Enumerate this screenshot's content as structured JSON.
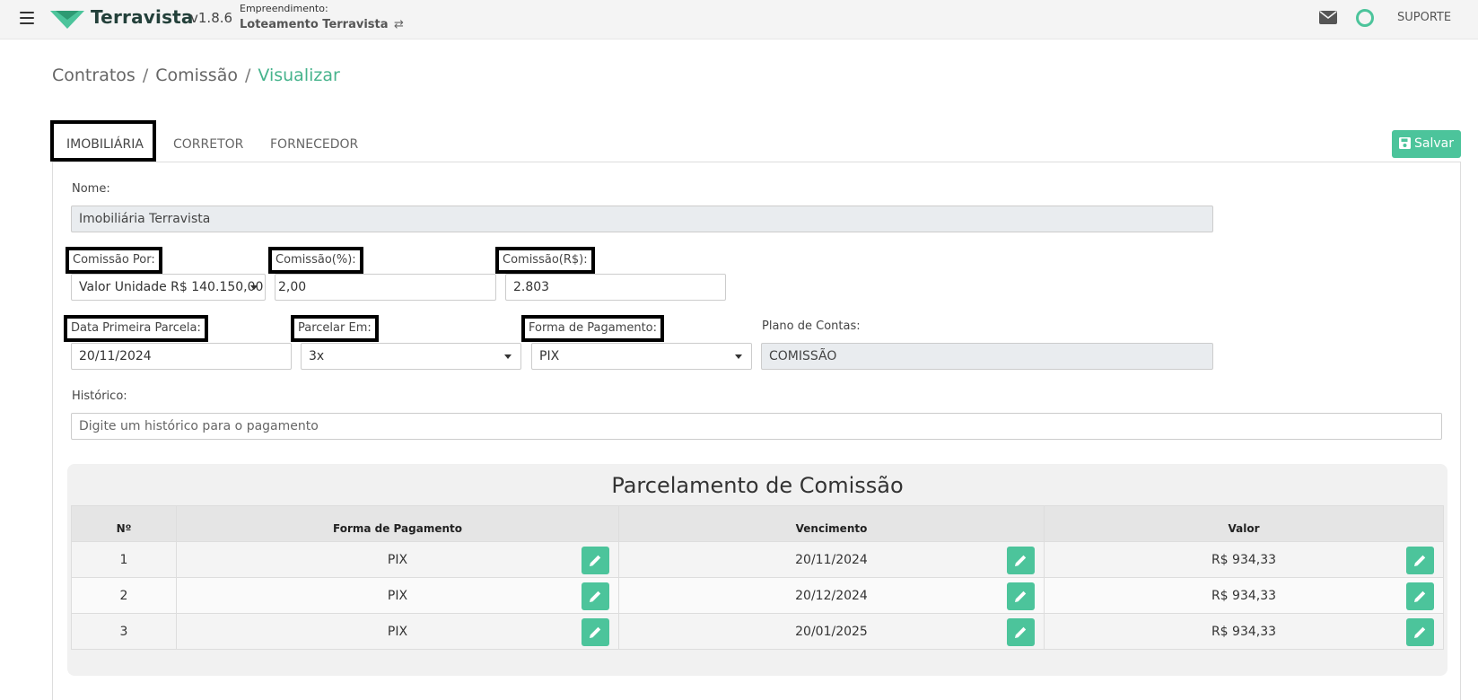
{
  "header": {
    "app_name": "Terravista",
    "version": "v1.8.6",
    "empreendimento_label": "Empreendimento:",
    "empreendimento_name": "Loteamento Terravista",
    "swap_icon": "⇄",
    "support_label": "SUPORTE",
    "brand_color": "#4cc49b"
  },
  "breadcrumb": {
    "items": [
      "Contratos",
      "Comissão"
    ],
    "separator": "/",
    "current": "Visualizar"
  },
  "tabs": [
    {
      "label": "IMOBILIÁRIA",
      "active": true
    },
    {
      "label": "CORRETOR",
      "active": false
    },
    {
      "label": "FORNECEDOR",
      "active": false
    }
  ],
  "actions": {
    "save_label": "Salvar"
  },
  "form": {
    "nome_label": "Nome:",
    "nome_value": "Imobiliária Terravista",
    "comissao_por_label": "Comissão Por:",
    "comissao_por_value": "Valor Unidade R$ 140.150,00",
    "comissao_pct_label": "Comissão(%):",
    "comissao_pct_value": "2,00",
    "comissao_rs_label": "Comissão(R$):",
    "comissao_rs_value": "2.803",
    "data_label": "Data Primeira Parcela:",
    "data_value": "20/11/2024",
    "parcelar_label": "Parcelar Em:",
    "parcelar_value": "3x",
    "forma_label": "Forma de Pagamento:",
    "forma_value": "PIX",
    "plano_label": "Plano de Contas:",
    "plano_value": "COMISSÃO",
    "historico_label": "Histórico:",
    "historico_placeholder": "Digite um histórico para o pagamento"
  },
  "installments": {
    "title": "Parcelamento de Comissão",
    "columns": [
      "Nº",
      "Forma de Pagamento",
      "Vencimento",
      "Valor"
    ],
    "rows": [
      {
        "n": "1",
        "forma": "PIX",
        "vencimento": "20/11/2024",
        "valor": "R$ 934,33"
      },
      {
        "n": "2",
        "forma": "PIX",
        "vencimento": "20/12/2024",
        "valor": "R$ 934,33"
      },
      {
        "n": "3",
        "forma": "PIX",
        "vencimento": "20/01/2025",
        "valor": "R$ 934,33"
      }
    ]
  }
}
